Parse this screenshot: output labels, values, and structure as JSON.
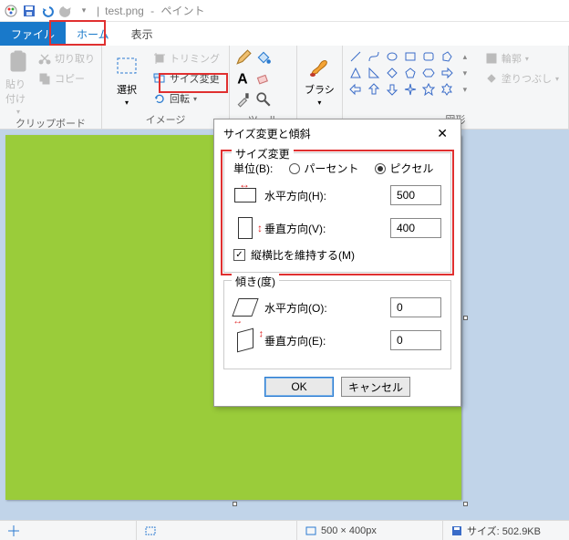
{
  "title": {
    "file": "test.png",
    "app": "ペイント"
  },
  "tabs": {
    "file": "ファイル",
    "home": "ホーム",
    "view": "表示"
  },
  "ribbon": {
    "clipboard": {
      "label": "クリップボード",
      "paste": "貼り付け",
      "cut": "切り取り",
      "copy": "コピー"
    },
    "image": {
      "label": "イメージ",
      "select": "選択",
      "trim": "トリミング",
      "resize": "サイズ変更",
      "rotate": "回転"
    },
    "tools": {
      "label": "ツール"
    },
    "brush": {
      "label": "ブラシ"
    },
    "shapes": {
      "label": "図形",
      "outline": "輪郭",
      "fill": "塗りつぶし"
    }
  },
  "dialog": {
    "title": "サイズ変更と傾斜",
    "resize": {
      "legend": "サイズ変更",
      "unit_label": "単位(B):",
      "percent": "パーセント",
      "pixel": "ピクセル",
      "horizontal": "水平方向(H):",
      "vertical": "垂直方向(V):",
      "h_value": "500",
      "v_value": "400",
      "aspect": "縦横比を維持する(M)"
    },
    "skew": {
      "legend": "傾き(度)",
      "horizontal": "水平方向(O):",
      "vertical": "垂直方向(E):",
      "h_value": "0",
      "v_value": "0"
    },
    "ok": "OK",
    "cancel": "キャンセル"
  },
  "status": {
    "dimensions": "500 × 400px",
    "filesize": "サイズ: 502.9KB"
  }
}
